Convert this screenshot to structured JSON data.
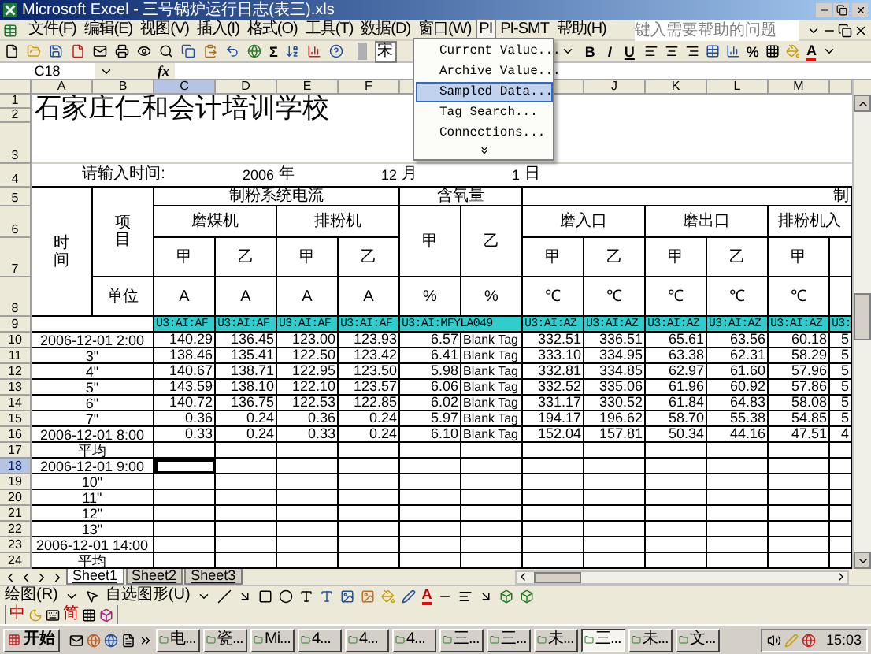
{
  "window": {
    "title": "Microsoft Excel - 三号锅炉运行日志(表三).xls"
  },
  "menu_bar": [
    {
      "label": "文件(F)",
      "selected": false
    },
    {
      "label": "编辑(E)",
      "selected": false
    },
    {
      "label": "视图(V)",
      "selected": false
    },
    {
      "label": "插入(I)",
      "selected": false
    },
    {
      "label": "格式(O)",
      "selected": false
    },
    {
      "label": "工具(T)",
      "selected": false
    },
    {
      "label": "数据(D)",
      "selected": false
    },
    {
      "label": "窗口(W)",
      "selected": false
    },
    {
      "label": "PI",
      "selected": true
    },
    {
      "label": "PI-SMT",
      "selected": false
    },
    {
      "label": "帮助(H)",
      "selected": false
    }
  ],
  "help_box": {
    "placeholder": "键入需要帮助的问题"
  },
  "toolbar": {
    "sum": "Σ",
    "font": "宋",
    "bold": "B",
    "italic": "I",
    "underline": "U",
    "percent": "%",
    "font_color": "A"
  },
  "pi_menu": [
    {
      "label": "Current Value...",
      "selected": false
    },
    {
      "label": "Archive Value...",
      "selected": false
    },
    {
      "label": "Sampled Data...",
      "selected": true
    },
    {
      "label": "Tag Search...",
      "selected": false
    },
    {
      "label": "Connections...",
      "selected": false
    }
  ],
  "formula_bar": {
    "name_box": "C18",
    "fx": "fx"
  },
  "sheet": {
    "column_headers": [
      {
        "label": "A",
        "selected": false
      },
      {
        "label": "B",
        "selected": false
      },
      {
        "label": "C",
        "selected": true
      },
      {
        "label": "D",
        "selected": false
      },
      {
        "label": "E",
        "selected": false
      },
      {
        "label": "F",
        "selected": false
      },
      {
        "label": "J",
        "selected": false
      },
      {
        "label": "K",
        "selected": false
      },
      {
        "label": "L",
        "selected": false
      },
      {
        "label": "M",
        "selected": false
      }
    ],
    "row_headers": [
      {
        "label": "1",
        "selected": false
      },
      {
        "label": "2",
        "selected": false
      },
      {
        "label": "3",
        "selected": false
      },
      {
        "label": "4",
        "selected": false
      },
      {
        "label": "5",
        "selected": false
      },
      {
        "label": "6",
        "selected": false
      },
      {
        "label": "7",
        "selected": false
      },
      {
        "label": "8",
        "selected": false
      },
      {
        "label": "9",
        "selected": false
      },
      {
        "label": "10",
        "selected": false
      },
      {
        "label": "11",
        "selected": false
      },
      {
        "label": "12",
        "selected": false
      },
      {
        "label": "13",
        "selected": false
      },
      {
        "label": "14",
        "selected": false
      },
      {
        "label": "15",
        "selected": false
      },
      {
        "label": "16",
        "selected": false
      },
      {
        "label": "17",
        "selected": false
      },
      {
        "label": "18",
        "selected": true
      },
      {
        "label": "19",
        "selected": false
      },
      {
        "label": "20",
        "selected": false
      },
      {
        "label": "21",
        "selected": false
      },
      {
        "label": "22",
        "selected": false
      },
      {
        "label": "23",
        "selected": false
      },
      {
        "label": "24",
        "selected": false
      }
    ],
    "title": "石家庄仁和会计培训学校",
    "date_prompt": {
      "label": "请输入时间:",
      "year": "2006",
      "year_unit": "年",
      "month": "12",
      "month_unit": "月",
      "day": "1",
      "day_unit": "日"
    },
    "header_cells": [
      "时间",
      "项目",
      "单位",
      "制粉系统电流",
      "含氧量",
      "制",
      "磨煤机",
      "排粉机",
      "甲",
      "乙",
      "磨入口",
      "磨出口",
      "排粉机入",
      "甲",
      "乙",
      "甲",
      "乙",
      "甲",
      "乙",
      "甲",
      "乙",
      "甲",
      "A",
      "A",
      "A",
      "A",
      "%",
      "%",
      "℃",
      "℃",
      "℃",
      "℃",
      "℃"
    ],
    "tags": [
      "U3:AI:AF",
      "U3:AI:AF",
      "U3:AI:AF",
      "U3:AI:AF",
      "U3:AI:MFYLA049",
      "U3:AI:AZ",
      "U3:AI:AZ",
      "U3:AI:AZ",
      "U3:AI:AZ",
      "U3:AI:AZ",
      "U3:"
    ],
    "rows": [
      {
        "time": "2006-12-01 2:00",
        "selected": false,
        "values": [
          "140.29",
          "136.45",
          "123.00",
          "123.93",
          "6.57",
          "Blank Tag",
          "332.51",
          "336.51",
          "65.61",
          "63.56",
          "60.18",
          "5"
        ]
      },
      {
        "time": "3\"",
        "selected": false,
        "values": [
          "138.46",
          "135.41",
          "122.50",
          "123.42",
          "6.41",
          "Blank Tag",
          "333.10",
          "334.95",
          "63.38",
          "62.31",
          "58.29",
          "5"
        ]
      },
      {
        "time": "4\"",
        "selected": false,
        "values": [
          "140.67",
          "138.71",
          "122.95",
          "123.50",
          "5.98",
          "Blank Tag",
          "332.81",
          "334.85",
          "62.97",
          "61.60",
          "57.96",
          "5"
        ]
      },
      {
        "time": "5\"",
        "selected": false,
        "values": [
          "143.59",
          "138.10",
          "122.10",
          "123.57",
          "6.06",
          "Blank Tag",
          "332.52",
          "335.06",
          "61.96",
          "60.92",
          "57.86",
          "5"
        ]
      },
      {
        "time": "6\"",
        "selected": false,
        "values": [
          "140.72",
          "136.75",
          "122.53",
          "122.85",
          "6.02",
          "Blank Tag",
          "331.17",
          "330.52",
          "61.84",
          "64.83",
          "58.08",
          "5"
        ]
      },
      {
        "time": "7\"",
        "selected": false,
        "values": [
          "0.36",
          "0.24",
          "0.36",
          "0.24",
          "5.97",
          "Blank Tag",
          "194.17",
          "196.62",
          "58.70",
          "55.38",
          "54.85",
          "5"
        ]
      },
      {
        "time": "2006-12-01 8:00",
        "selected": false,
        "values": [
          "0.33",
          "0.24",
          "0.33",
          "0.24",
          "6.10",
          "Blank Tag",
          "152.04",
          "157.81",
          "50.34",
          "44.16",
          "47.51",
          "4"
        ]
      },
      {
        "time": "平均",
        "selected": false
      },
      {
        "time": "2006-12-01 9:00",
        "selected": true
      },
      {
        "time": "10\"",
        "selected": false
      },
      {
        "time": "11\"",
        "selected": false
      },
      {
        "time": "12\"",
        "selected": false
      },
      {
        "time": "13\"",
        "selected": false
      },
      {
        "time": "2006-12-01 14:00",
        "selected": false
      },
      {
        "time": "平均",
        "selected": false
      }
    ]
  },
  "sheet_tabs": [
    {
      "label": "Sheet1",
      "selected": true
    },
    {
      "label": "Sheet2",
      "selected": false
    },
    {
      "label": "Sheet3",
      "selected": false
    }
  ],
  "drawing_toolbar": {
    "draw": "绘图(R)",
    "autoshapes": "自选图形(U)",
    "font_color": "A"
  },
  "ime_bar": {
    "mode": "中",
    "charset": "简"
  },
  "taskbar": {
    "start": "开始",
    "tasks": [
      {
        "label": "电...",
        "selected": false
      },
      {
        "label": "瓷...",
        "selected": false
      },
      {
        "label": "Mi...",
        "selected": false
      },
      {
        "label": "4...",
        "selected": false
      },
      {
        "label": "4...",
        "selected": false
      },
      {
        "label": "4...",
        "selected": false
      },
      {
        "label": "三...",
        "selected": false
      },
      {
        "label": "三...",
        "selected": false
      },
      {
        "label": "未...",
        "selected": false
      },
      {
        "label": "三...",
        "selected": true
      },
      {
        "label": "未...",
        "selected": false
      },
      {
        "label": "文...",
        "selected": false
      }
    ],
    "clock": "15:03"
  }
}
